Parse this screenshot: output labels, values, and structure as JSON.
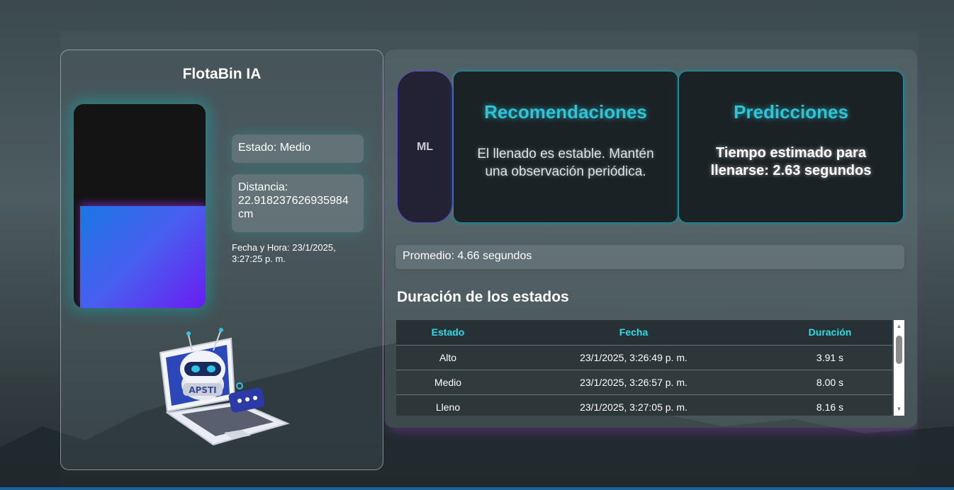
{
  "app": {
    "title": "FlotaBin IA"
  },
  "bin": {
    "fill_level_fraction": 0.5
  },
  "status": {
    "estado": "Estado: Medio",
    "distancia": "Distancia: 22.918237626935984 cm",
    "fecha_hora": "Fecha y Hora: 23/1/2025, 3:27:25 p. m."
  },
  "cards": {
    "ml_label": "ML",
    "recomendaciones": {
      "title": "Recomendaciones",
      "body": "El llenado es estable. Mantén una observación periódica."
    },
    "predicciones": {
      "title": "Predicciones",
      "body": "Tiempo estimado para llenarse: 2.63 segundos"
    }
  },
  "promedio": "Promedio: 4.66 segundos",
  "durations": {
    "title": "Duración de los estados",
    "headers": {
      "estado": "Estado",
      "fecha": "Fecha",
      "duracion": "Duración"
    },
    "rows": [
      {
        "estado": "Alto",
        "fecha": "23/1/2025, 3:26:49 p. m.",
        "duracion": "3.91 s"
      },
      {
        "estado": "Medio",
        "fecha": "23/1/2025, 3:26:57 p. m.",
        "duracion": "8.00 s"
      },
      {
        "estado": "Lleno",
        "fecha": "23/1/2025, 3:27:05 p. m.",
        "duracion": "8.16 s"
      }
    ]
  },
  "illustration": {
    "label": "APSTI"
  },
  "colors": {
    "accent": "#2ec4d6",
    "table_header_text": "#2fdde8",
    "fill_gradient_start": "#1977e3",
    "fill_gradient_end": "#6a1cf2"
  }
}
